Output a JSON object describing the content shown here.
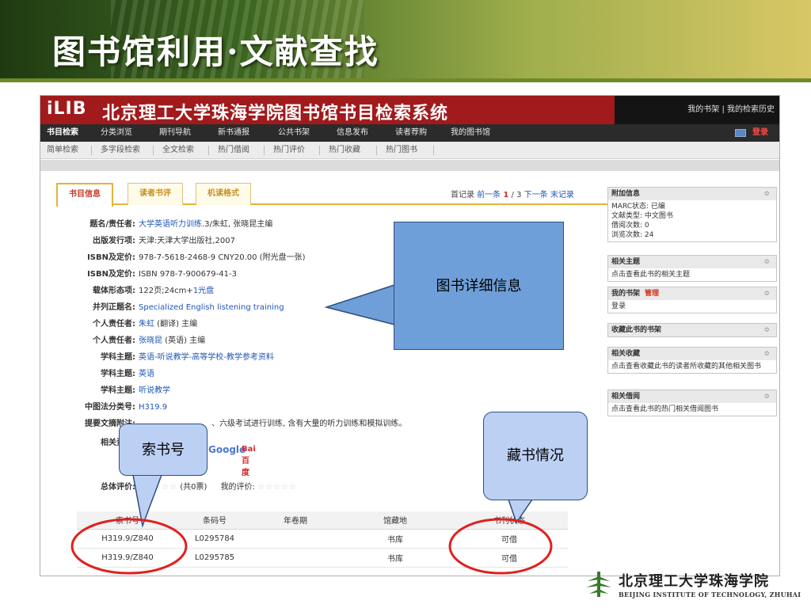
{
  "slide": {
    "title": "图书馆利用·文献查找",
    "footer_cn": "北京理工大学珠海学院",
    "footer_en": "BEIJING INSTITUTE OF TECHNOLOGY, ZHUHAI"
  },
  "app": {
    "logo": "iLIB",
    "title": "北京理工大学珠海学院图书馆书目检索系统",
    "top_links": [
      "我的书架",
      "我的检索历史"
    ]
  },
  "nav": {
    "items": [
      "书目检索",
      "分类浏览",
      "期刊导航",
      "新书通报",
      "公共书架",
      "信息发布",
      "读者荐购",
      "我的图书馆"
    ],
    "login": "登录"
  },
  "subnav": {
    "items": [
      "简单检索",
      "多字段检索",
      "全文检索",
      "热门借阅",
      "热门评价",
      "热门收藏",
      "热门图书"
    ]
  },
  "tabs": [
    "书目信息",
    "读者书评",
    "机读格式"
  ],
  "record_nav": {
    "first": "首记录",
    "prev": "前一条",
    "current": "1",
    "sep": " / ",
    "total": "3",
    "next": "下一条",
    "last": "末记录"
  },
  "detail": [
    {
      "label": "题名/责任者:",
      "link": "大学英语听力训练",
      "text": ".3/朱虹, 张晓昆主编"
    },
    {
      "label": "出版发行项:",
      "text": "天津:天津大学出版社,2007"
    },
    {
      "label": "ISBN及定价:",
      "text": "978-7-5618-2468-9 CNY20.00 (附光盘一张)"
    },
    {
      "label": "ISBN及定价:",
      "text": "ISBN 978-7-900679-41-3"
    },
    {
      "label": "载体形态项:",
      "text": "122页;24cm+",
      "link": "1光盘"
    },
    {
      "label": "并列正题名:",
      "link": "Specialized English listening training"
    },
    {
      "label": "个人责任者:",
      "link": "朱虹",
      "text": " (翻译) 主编"
    },
    {
      "label": "个人责任者:",
      "link": "张晓昆",
      "text": " (英语) 主编"
    },
    {
      "label": "学科主题:",
      "link": "英语-听说教学-高等学校-教学参考资料"
    },
    {
      "label": "学科主题:",
      "link": "英语"
    },
    {
      "label": "学科主题:",
      "link": "听说教学"
    },
    {
      "label": "中图法分类号:",
      "link": "H319.9"
    },
    {
      "label": "提要文摘附注:",
      "text": "、六级考试进行训练, 含有大量的听力训练和模拟训练。"
    },
    {
      "label": "相关资源:",
      "google": "Google",
      "baidu": "Bai百度"
    }
  ],
  "rating": {
    "label": "总体评价:",
    "count": "(共0票)",
    "my_label": "我的评价:",
    "stars": "☆☆☆☆☆"
  },
  "holdings": {
    "columns": [
      "索书号",
      "条码号",
      "年卷期",
      "馆藏地",
      "书刊状态"
    ],
    "rows": [
      [
        "H319.9/Z840",
        "L0295784",
        "",
        "书库",
        "可借"
      ],
      [
        "H319.9/Z840",
        "L0295785",
        "",
        "书库",
        "可借"
      ]
    ]
  },
  "side": [
    {
      "title": "附加信息",
      "lines": [
        "MARC状态: 已编",
        "文献类型: 中文图书",
        "借阅次数: 0",
        "浏览次数: 24"
      ]
    },
    {
      "title": "相关主题",
      "lines": [
        "点击查看此书的相关主题"
      ]
    },
    {
      "title": "我的书架",
      "manage": "管理",
      "lines": [
        "登录"
      ]
    },
    {
      "title": "收藏此书的书架",
      "lines": []
    },
    {
      "title": "相关收藏",
      "lines": [
        "点击查看收藏此书的读者所收藏的其他相关图书"
      ]
    },
    {
      "title": "相关借阅",
      "lines": [
        "点击查看此书的热门相关借阅图书"
      ]
    }
  ],
  "side_toggle": "≎",
  "callouts": {
    "main": "图书详细信息",
    "call_number": "索书号",
    "holdings": "藏书情况"
  },
  "colors": {
    "app_red": "#a11a1c",
    "link_blue": "#1f56b5",
    "callout_blue": "#6f9fd8",
    "highlight_red": "#e02020"
  }
}
